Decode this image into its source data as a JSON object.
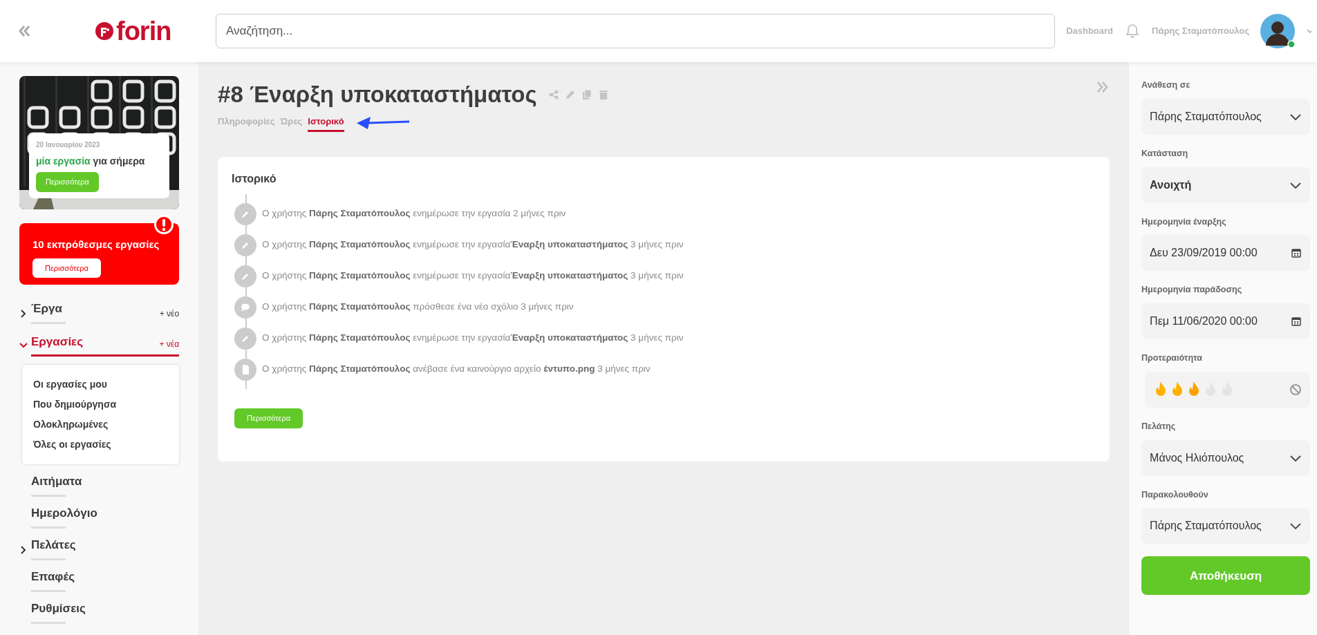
{
  "header": {
    "brand": "forin",
    "search": {
      "placeholder": "Αναζήτηση..."
    },
    "links": [
      "Dashboard"
    ],
    "user_name": "Πάρης Σταματόπουλος",
    "online": true
  },
  "sidebar": {
    "today_card": {
      "date": "20 Ιανουαρίου 2023",
      "highlight": "μία εργασία",
      "text": "για σήμερα",
      "button": "Περισσότερα"
    },
    "overdue_card": {
      "text": "10 εκπρόθεσμες εργασίες",
      "button": "Περισσότερα"
    },
    "nav": [
      {
        "label": "Έργα",
        "expanded": false,
        "selected": false,
        "add_label": "+ νέο"
      },
      {
        "label": "Εργασίες",
        "expanded": true,
        "selected": true,
        "add_label": "+ νέα",
        "children": [
          {
            "label": "Οι εργασίες μου"
          },
          {
            "label": "Που δημιούργησα"
          },
          {
            "label": "Ολοκληρωμένες"
          },
          {
            "label": "Όλες οι εργασίες"
          }
        ]
      },
      {
        "label": "Αιτήματα",
        "selected": false
      },
      {
        "label": "Ημερολόγιο",
        "selected": false
      },
      {
        "label": "Πελάτες",
        "expanded": false,
        "selected": false
      },
      {
        "label": "Επαφές",
        "selected": false
      },
      {
        "label": "Ρυθμίσεις",
        "selected": false
      }
    ]
  },
  "task": {
    "title": "#8 Έναρξη υποκαταστήματος",
    "tabs": [
      {
        "label": "Πληροφορίες",
        "selected": false
      },
      {
        "label": "Ώρες",
        "selected": false
      },
      {
        "label": "Ιστορικό",
        "selected": true
      }
    ],
    "history": {
      "title": "Ιστορικό",
      "events": [
        {
          "kind": "edit",
          "text": "Ο χρήστης **Πάρης Σταματόπουλος** ενημέρωσε την εργασία 2 μήνες πριν"
        },
        {
          "kind": "edit",
          "text": "Ο χρήστης **Πάρης Σταματόπουλος** ενημέρωσε την εργασία**Έναρξη υποκαταστήματος** 3 μήνες πριν"
        },
        {
          "kind": "edit",
          "text": "Ο χρήστης **Πάρης Σταματόπουλος** ενημέρωσε την εργασία**Έναρξη υποκαταστήματος** 3 μήνες πριν"
        },
        {
          "kind": "comment",
          "text": "Ο χρήστης **Πάρης Σταματόπουλος** πρόσθεσε ένα νέο σχόλιο 3 μήνες πριν"
        },
        {
          "kind": "edit",
          "text": "Ο χρήστης **Πάρης Σταματόπουλος** ενημέρωσε την εργασία**Έναρξη υποκαταστήματος** 3 μήνες πριν"
        },
        {
          "kind": "file",
          "text": "Ο χρήστης **Πάρης Σταματόπουλος** ανέβασε ένα καινούργιο αρχείο **έντυπο.png** 3 μήνες πριν"
        }
      ],
      "button": "Περισσότερα"
    }
  },
  "details": {
    "fields": [
      {
        "kind": "select",
        "label": "Ανάθεση σε",
        "value": "Πάρης Σταματόπουλος"
      },
      {
        "kind": "select",
        "label": "Κατάσταση",
        "value": "Ανοιχτή",
        "emphasis": true
      },
      {
        "kind": "date",
        "label": "Ημερομηνία έναρξης",
        "value": "Δευ 23/09/2019 00:00"
      },
      {
        "kind": "date",
        "label": "Ημερομηνία παράδοσης",
        "value": "Πεμ 11/06/2020 00:00"
      },
      {
        "kind": "rating",
        "label": "Προτεραιότητα",
        "stars": 3
      },
      {
        "kind": "select",
        "label": "Πελάτης",
        "value": "Μάνος Ηλιόπουλος"
      },
      {
        "kind": "select",
        "label": "Παρακολουθούν",
        "value": "Πάρης Σταματόπουλος"
      }
    ],
    "save_button": "Αποθήκευση"
  }
}
